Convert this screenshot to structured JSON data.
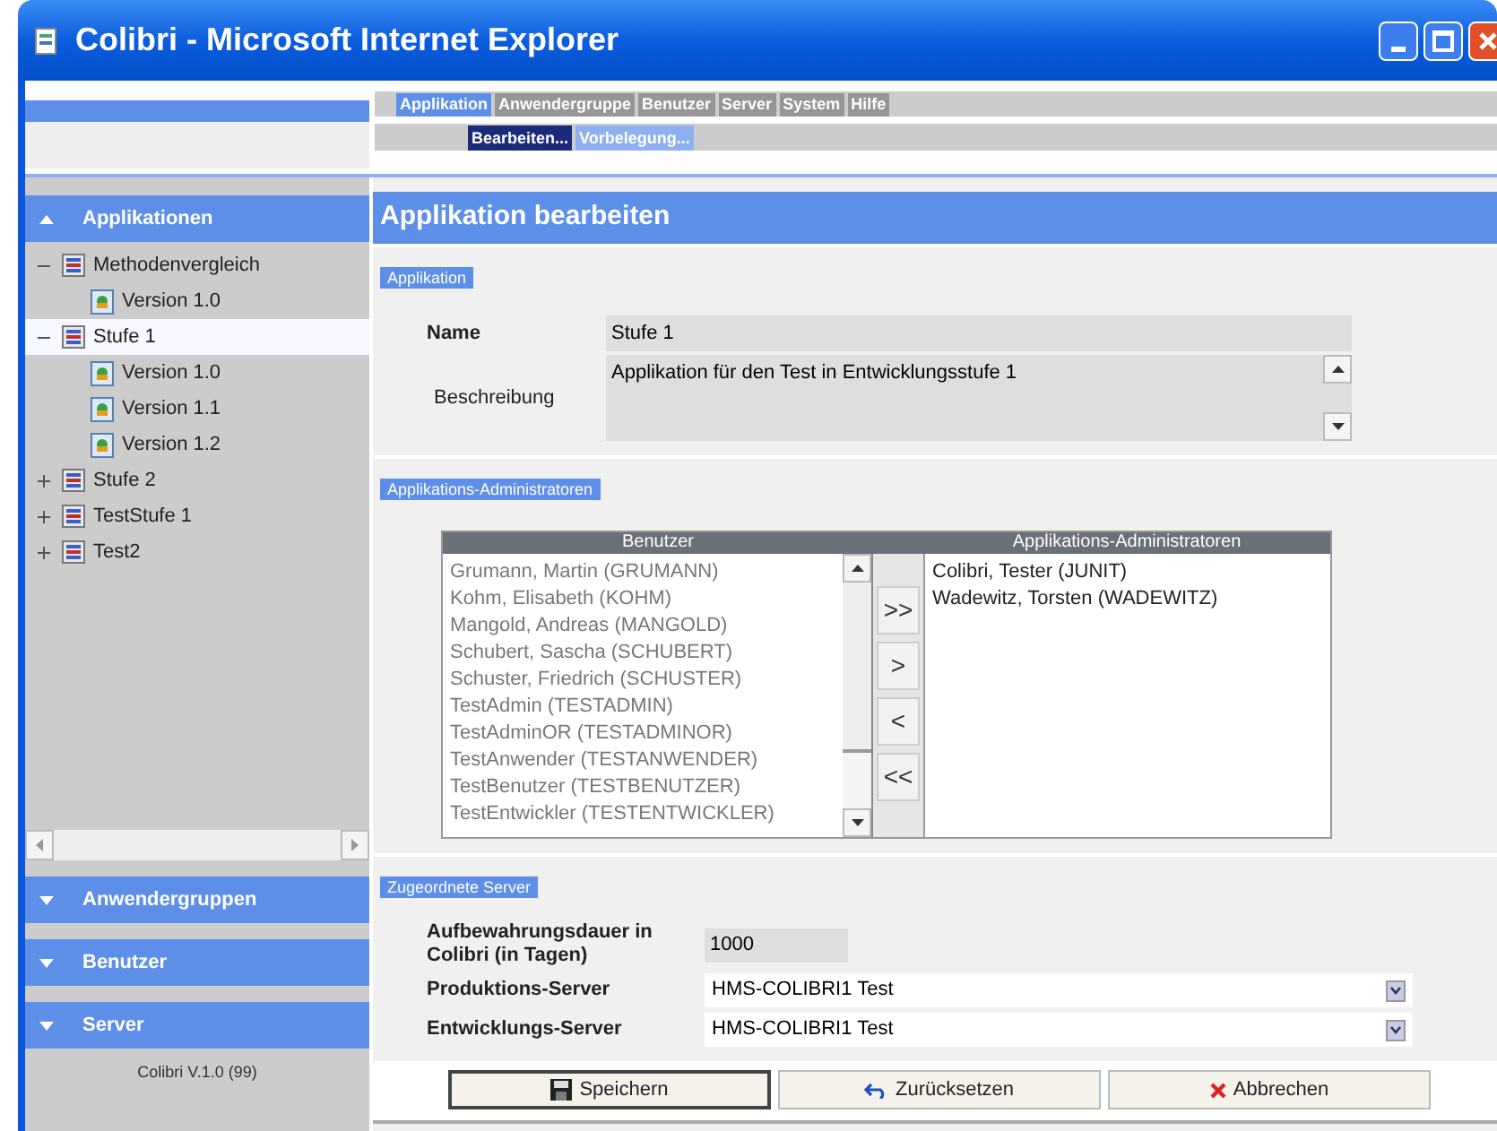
{
  "window": {
    "title": "Colibri - Microsoft Internet Explorer"
  },
  "menu": {
    "tabs": [
      {
        "label": "Applikation",
        "selected": true
      },
      {
        "label": "Anwendergruppe",
        "selected": false
      },
      {
        "label": "Benutzer",
        "selected": false
      },
      {
        "label": "Server",
        "selected": false
      },
      {
        "label": "System",
        "selected": false
      },
      {
        "label": "Hilfe",
        "selected": false
      }
    ],
    "subitems": [
      {
        "label": "Bearbeiten...",
        "selected": true
      },
      {
        "label": "Vorbelegung...",
        "selected": false
      }
    ]
  },
  "sidebar": {
    "sections": [
      {
        "label": "Applikationen",
        "expanded": true,
        "tree": [
          {
            "label": "Methodenvergleich",
            "kind": "app",
            "expanded": true,
            "selected": false,
            "children": [
              {
                "label": "Version 1.0",
                "kind": "version",
                "selected": false
              }
            ]
          },
          {
            "label": "Stufe 1",
            "kind": "app",
            "expanded": true,
            "selected": true,
            "children": [
              {
                "label": "Version 1.0",
                "kind": "version",
                "selected": false
              },
              {
                "label": "Version 1.1",
                "kind": "version",
                "selected": false
              },
              {
                "label": "Version 1.2",
                "kind": "version",
                "selected": false
              }
            ]
          },
          {
            "label": "Stufe 2",
            "kind": "app",
            "expanded": false,
            "selected": false
          },
          {
            "label": "TestStufe 1",
            "kind": "app",
            "expanded": false,
            "selected": false
          },
          {
            "label": "Test2",
            "kind": "app",
            "expanded": false,
            "selected": false
          }
        ]
      },
      {
        "label": "Anwendergruppen",
        "expanded": false
      },
      {
        "label": "Benutzer",
        "expanded": false
      },
      {
        "label": "Server",
        "expanded": false
      }
    ],
    "version": "Colibri V.1.0 (99)"
  },
  "page": {
    "title": "Applikation bearbeiten",
    "application": {
      "heading": "Applikation",
      "name_label": "Name",
      "name_value": "Stufe 1",
      "description_label": "Beschreibung",
      "description_value": "Applikation für den Test in Entwicklungsstufe 1"
    },
    "admins": {
      "heading": "Applikations-Administratoren",
      "users_header": "Benutzer",
      "admins_header": "Applikations-Administratoren",
      "users": [
        "Grumann, Martin (GRUMANN)",
        "Kohm, Elisabeth (KOHM)",
        "Mangold, Andreas (MANGOLD)",
        "Schubert, Sascha (SCHUBERT)",
        "Schuster, Friedrich (SCHUSTER)",
        "TestAdmin (TESTADMIN)",
        "TestAdminOR (TESTADMINOR)",
        "TestAnwender (TESTANWENDER)",
        "TestBenutzer (TESTBENUTZER)",
        "TestEntwickler (TESTENTWICKLER)"
      ],
      "move_buttons": [
        ">>",
        ">",
        "<",
        "<<"
      ],
      "admins": [
        "Colibri, Tester (JUNIT)",
        "Wadewitz, Torsten (WADEWITZ)"
      ]
    },
    "servers": {
      "heading": "Zugeordnete Server",
      "retention_label": "Aufbewahrungsdauer in Colibri (in Tagen)",
      "retention_value": "1000",
      "production_label": "Produktions-Server",
      "production_value": "HMS-COLIBRI1 Test",
      "development_label": "Entwicklungs-Server",
      "development_value": "HMS-COLIBRI1 Test"
    },
    "buttons": [
      {
        "label": "Speichern",
        "kind": "save"
      },
      {
        "label": "Zurücksetzen",
        "kind": "reset"
      },
      {
        "label": "Abbrechen",
        "kind": "cancel"
      }
    ]
  }
}
